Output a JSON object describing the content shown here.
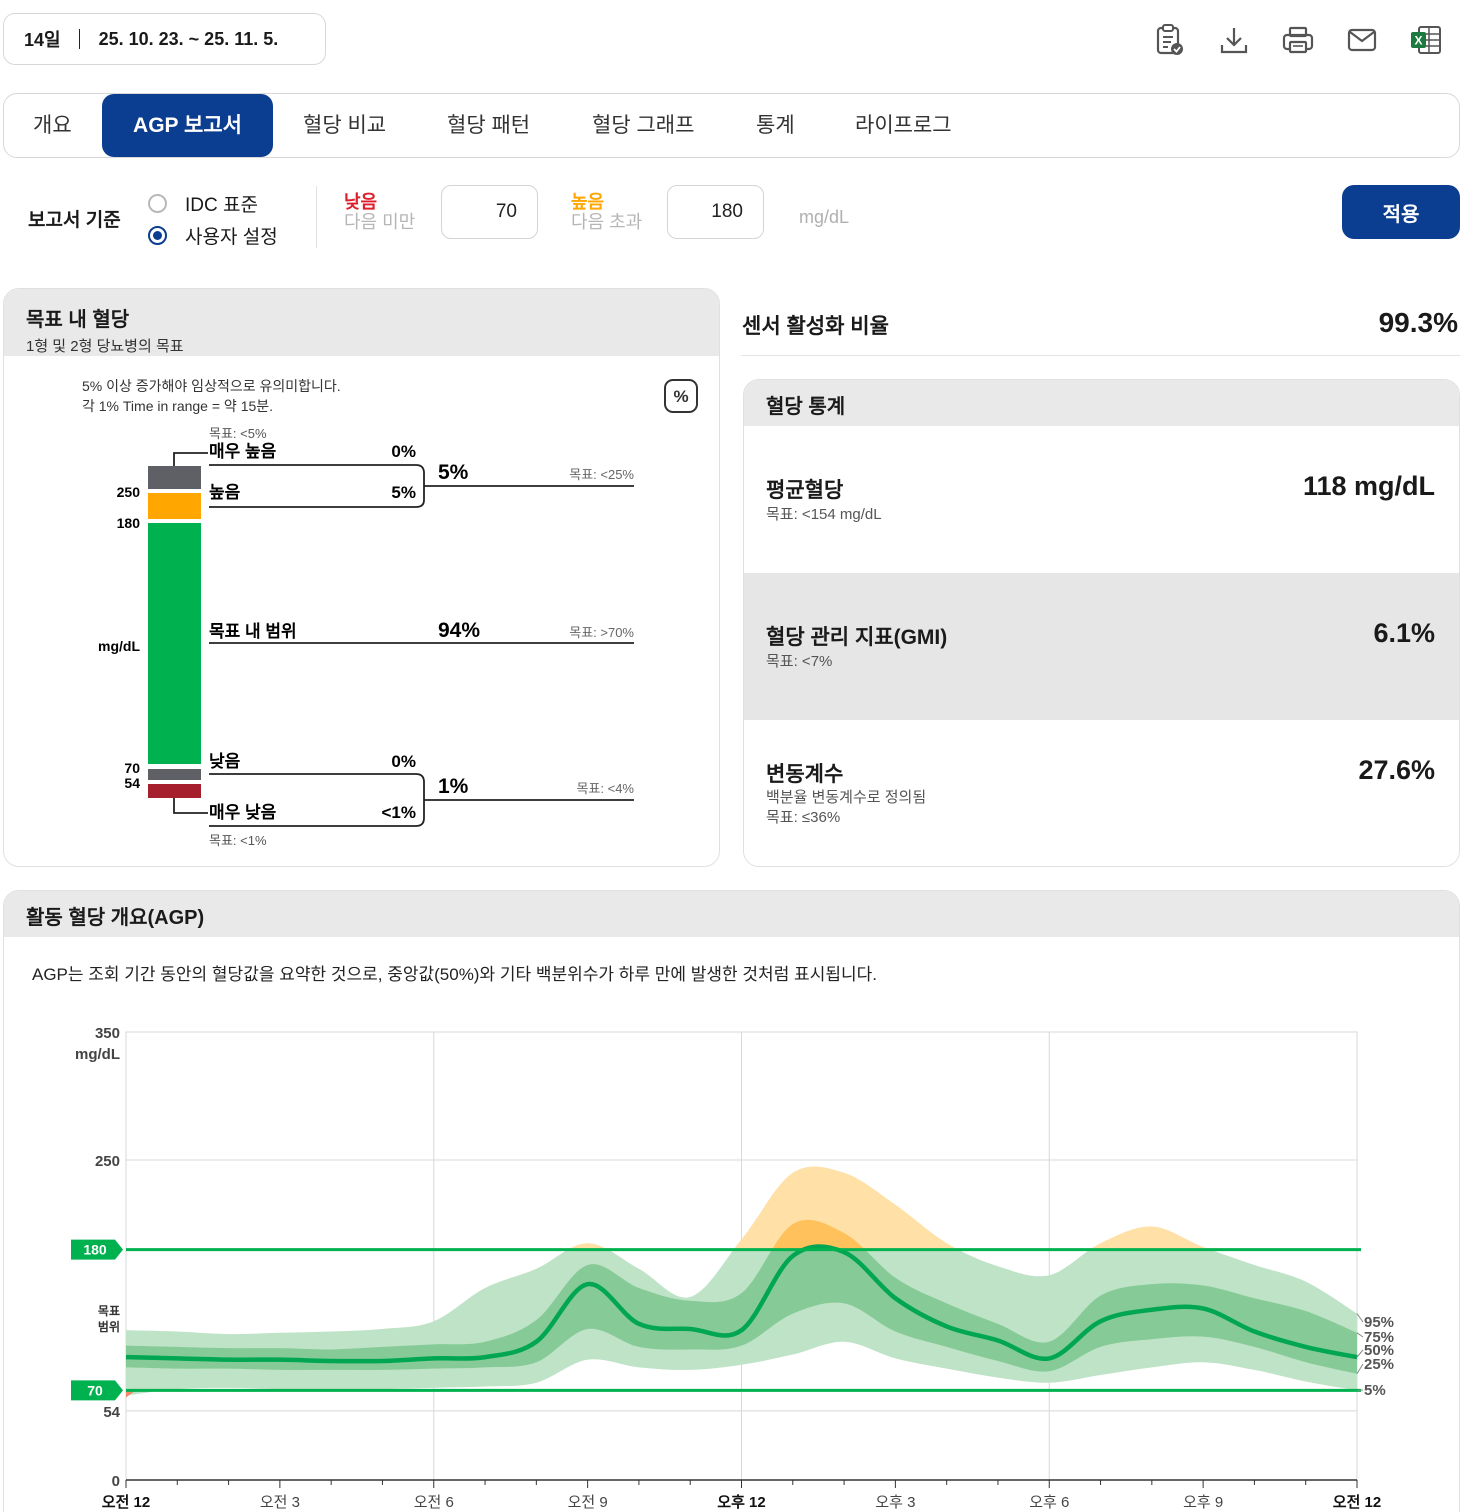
{
  "header": {
    "days": "14일",
    "range": "25. 10. 23. ~ 25. 11. 5."
  },
  "toolbar": [
    "clipboard-check-icon",
    "download-icon",
    "print-icon",
    "mail-icon",
    "excel-icon"
  ],
  "tabs": [
    "개요",
    "AGP 보고서",
    "혈당 비교",
    "혈당 패턴",
    "혈당 그래프",
    "통계",
    "라이프로그"
  ],
  "active_tab": "AGP 보고서",
  "criteria": {
    "label": "보고서 기준",
    "option_idc": "IDC 표준",
    "option_custom": "사용자 설정",
    "low_title": "낮음",
    "low_sub": "다음 미만",
    "low_value": "70",
    "high_title": "높음",
    "high_sub": "다음 초과",
    "high_value": "180",
    "unit": "mg/dL",
    "apply": "적용",
    "selected": "사용자 설정"
  },
  "tir": {
    "title": "목표 내 혈당",
    "subtitle": "1형 및 2형 당뇨병의 목표",
    "note1": "5% 이상 증가해야 임상적으로 유의미합니다.",
    "note2": "각 1% Time in range = 약 15분.",
    "percent_icon": "%",
    "axis_unit": "mg/dL",
    "ticks": [
      "250",
      "180",
      "70",
      "54"
    ],
    "very_high": {
      "label": "매우 높음",
      "value": "0%",
      "goal": "목표: <5%"
    },
    "high": {
      "label": "높음",
      "value": "5%"
    },
    "high_total": {
      "value": "5%",
      "goal": "목표: <25%"
    },
    "in_range": {
      "label": "목표 내 범위",
      "value": "94%",
      "goal": "목표: >70%"
    },
    "low": {
      "label": "낮음",
      "value": "0%"
    },
    "very_low": {
      "label": "매우 낮음",
      "value": "<1%",
      "goal": "목표: <1%"
    },
    "low_total": {
      "value": "1%",
      "goal": "목표: <4%"
    },
    "colors": {
      "very_high": "#5f5f66",
      "high": "#ffa600",
      "in_range": "#00b14f",
      "low": "#5f5f66",
      "very_low": "#a51f2d"
    }
  },
  "sensor": {
    "label": "센서 활성화 비율",
    "value": "99.3%"
  },
  "stats": {
    "title": "혈당 통계",
    "mean": {
      "label": "평균혈당",
      "goal": "목표: <154 mg/dL",
      "value": "118 mg/dL"
    },
    "gmi": {
      "label": "혈당 관리 지표(GMI)",
      "goal": "목표: <7%",
      "value": "6.1%"
    },
    "cv": {
      "label": "변동계수",
      "desc": "백분율 변동계수로 정의됨",
      "goal": "목표: ≤36%",
      "value": "27.6%"
    }
  },
  "agp": {
    "title": "활동 혈당 개요(AGP)",
    "desc": "AGP는 조회 기간 동안의 혈당값을 요약한 것으로, 중앙값(50%)와 기타 백분위수가 하루 만에 발생한 것처럼 표시됩니다.",
    "y_unit": "mg/dL",
    "target_label": "목표 범위",
    "percentile_labels": [
      "95%",
      "75%",
      "50%",
      "25%",
      "5%"
    ],
    "bold_x_labels": [
      "오전 12",
      "오후 12"
    ]
  },
  "chart_data": {
    "type": "area",
    "title": "",
    "xlabel": "",
    "ylabel": "mg/dL",
    "ylim": [
      0,
      350
    ],
    "yticks": [
      0,
      54,
      70,
      180,
      250,
      350
    ],
    "target_low": 70,
    "target_high": 180,
    "x": [
      0,
      1,
      2,
      3,
      4,
      5,
      6,
      7,
      8,
      9,
      10,
      11,
      12,
      13,
      14,
      15,
      16,
      17,
      18,
      19,
      20,
      21,
      22,
      23,
      24
    ],
    "x_labels": [
      "오전 12",
      "오전 3",
      "오전 6",
      "오전 9",
      "오후 12",
      "오후 3",
      "오후 6",
      "오후 9",
      "오전 12"
    ],
    "x_label_hours": [
      0,
      3,
      6,
      9,
      12,
      15,
      18,
      21,
      24
    ],
    "series": [
      {
        "name": "95%",
        "values": [
          117,
          116,
          114,
          115,
          116,
          118,
          124,
          150,
          165,
          185,
          165,
          143,
          188,
          240,
          240,
          215,
          185,
          167,
          160,
          185,
          198,
          182,
          168,
          155,
          130
        ]
      },
      {
        "name": "75%",
        "values": [
          105,
          104,
          103,
          103,
          102,
          104,
          106,
          108,
          125,
          168,
          150,
          140,
          146,
          200,
          193,
          158,
          138,
          122,
          108,
          144,
          153,
          152,
          142,
          132,
          115
        ]
      },
      {
        "name": "50%",
        "values": [
          96,
          95,
          94,
          94,
          93,
          93,
          95,
          96,
          108,
          153,
          122,
          118,
          117,
          175,
          178,
          142,
          120,
          109,
          95,
          124,
          133,
          134,
          116,
          104,
          96
        ]
      },
      {
        "name": "25%",
        "values": [
          88,
          87,
          87,
          86,
          86,
          86,
          87,
          88,
          92,
          118,
          104,
          102,
          105,
          130,
          138,
          116,
          104,
          93,
          85,
          104,
          110,
          112,
          104,
          92,
          83
        ]
      },
      {
        "name": "5%",
        "values": [
          66,
          71,
          72,
          71,
          70,
          71,
          72,
          73,
          76,
          94,
          88,
          86,
          90,
          98,
          108,
          95,
          87,
          80,
          76,
          82,
          88,
          92,
          86,
          77,
          70
        ]
      }
    ]
  }
}
